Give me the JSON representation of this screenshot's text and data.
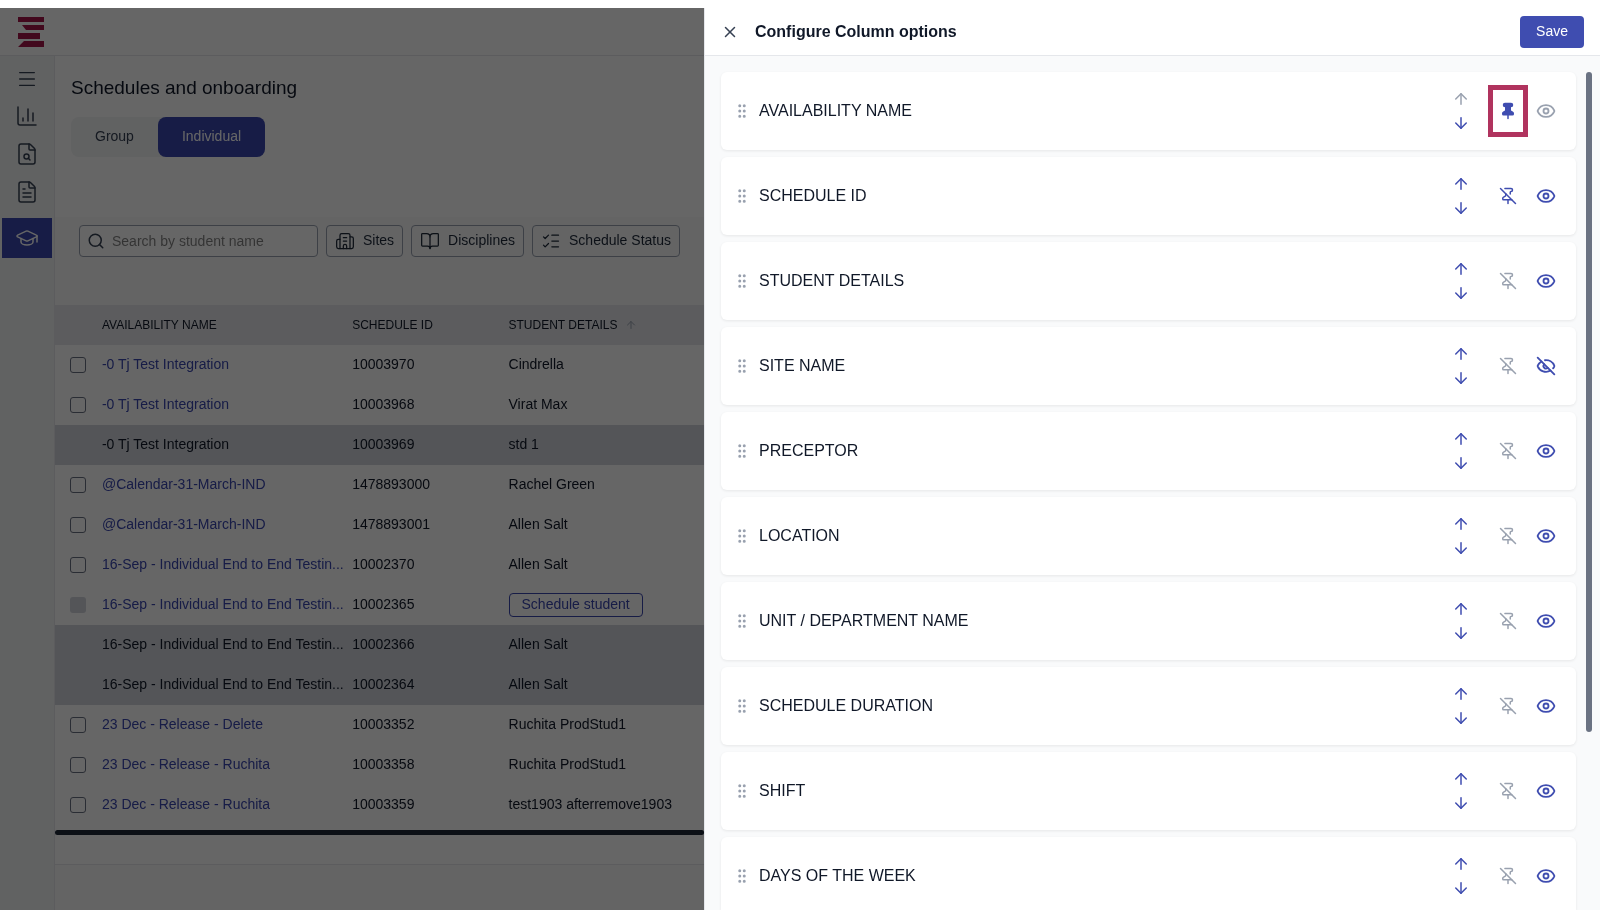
{
  "page": {
    "title": "Schedules and onboarding",
    "tabs": [
      {
        "label": "Group",
        "selected": false
      },
      {
        "label": "Individual",
        "selected": true
      }
    ],
    "search": {
      "placeholder": "Search by student name"
    },
    "filters": [
      {
        "label": "Sites",
        "kind": "sites"
      },
      {
        "label": "Disciplines",
        "kind": "book"
      },
      {
        "label": "Schedule Status",
        "kind": "list"
      }
    ],
    "table": {
      "columns": [
        {
          "label": "AVAILABILITY NAME",
          "sorted": false
        },
        {
          "label": "SCHEDULE ID",
          "sorted": false
        },
        {
          "label": "STUDENT DETAILS",
          "sorted": true
        }
      ],
      "rows": [
        {
          "checkbox": {
            "checked": false,
            "disabled": false
          },
          "name": "-0 Tj Test Integration",
          "link": true,
          "id": "10003970",
          "student": "Cindrella",
          "kind": "text",
          "shaded": false
        },
        {
          "checkbox": {
            "checked": false,
            "disabled": false
          },
          "name": "-0 Tj Test Integration",
          "link": true,
          "id": "10003968",
          "student": "Virat Max",
          "kind": "text",
          "shaded": false
        },
        {
          "name": "-0 Tj Test Integration",
          "link": false,
          "id": "10003969",
          "student": "std 1",
          "kind": "text",
          "shaded": true
        },
        {
          "checkbox": {
            "checked": false,
            "disabled": false
          },
          "name": "@Calendar-31-March-IND",
          "link": true,
          "id": "1478893000",
          "student": "Rachel Green",
          "kind": "text",
          "shaded": false
        },
        {
          "checkbox": {
            "checked": false,
            "disabled": false
          },
          "name": "@Calendar-31-March-IND",
          "link": true,
          "id": "1478893001",
          "student": "Allen Salt",
          "kind": "text",
          "shaded": false
        },
        {
          "checkbox": {
            "checked": false,
            "disabled": false
          },
          "name": "16-Sep - Individual End to End Testin...",
          "link": true,
          "id": "10002370",
          "student": "Allen Salt",
          "kind": "text",
          "shaded": false
        },
        {
          "checkbox": {
            "checked": false,
            "disabled": true
          },
          "name": "16-Sep - Individual End to End Testin...",
          "link": true,
          "id": "10002365",
          "student": "Schedule student",
          "kind": "button",
          "shaded": false
        },
        {
          "name": "16-Sep - Individual End to End Testin...",
          "link": false,
          "id": "10002366",
          "student": "Allen Salt",
          "kind": "text",
          "shaded": true
        },
        {
          "name": "16-Sep - Individual End to End Testin...",
          "link": false,
          "id": "10002364",
          "student": "Allen Salt",
          "kind": "text",
          "shaded": true
        },
        {
          "checkbox": {
            "checked": false,
            "disabled": false
          },
          "name": "23 Dec - Release - Delete",
          "link": true,
          "id": "10003352",
          "student": "Ruchita ProdStud1",
          "kind": "text",
          "shaded": false
        },
        {
          "checkbox": {
            "checked": false,
            "disabled": false
          },
          "name": "23 Dec - Release - Ruchita",
          "link": true,
          "id": "10003358",
          "student": "Ruchita ProdStud1",
          "kind": "text",
          "shaded": false
        },
        {
          "checkbox": {
            "checked": false,
            "disabled": false
          },
          "name": "23 Dec - Release - Ruchita",
          "link": true,
          "id": "10003359",
          "student": "test1903 afterremove1903",
          "kind": "text",
          "shaded": false
        }
      ]
    }
  },
  "drawer": {
    "title": "Configure Column options",
    "save": "Save",
    "columns": [
      {
        "label": "AVAILABILITY NAME",
        "up_disabled": true,
        "pinned": true,
        "pin_disabled": false,
        "highlighted": true,
        "visible": true,
        "eye_disabled": true
      },
      {
        "label": "SCHEDULE ID",
        "up_disabled": false,
        "pinned": false,
        "pin_disabled": false,
        "highlighted": false,
        "visible": true,
        "eye_disabled": false
      },
      {
        "label": "STUDENT DETAILS",
        "up_disabled": false,
        "pinned": false,
        "pin_disabled": true,
        "highlighted": false,
        "visible": true,
        "eye_disabled": false
      },
      {
        "label": "SITE NAME",
        "up_disabled": false,
        "pinned": false,
        "pin_disabled": true,
        "highlighted": false,
        "visible": false,
        "eye_disabled": false
      },
      {
        "label": "PRECEPTOR",
        "up_disabled": false,
        "pinned": false,
        "pin_disabled": true,
        "highlighted": false,
        "visible": true,
        "eye_disabled": false
      },
      {
        "label": "LOCATION",
        "up_disabled": false,
        "pinned": false,
        "pin_disabled": true,
        "highlighted": false,
        "visible": true,
        "eye_disabled": false
      },
      {
        "label": "UNIT / DEPARTMENT NAME",
        "up_disabled": false,
        "pinned": false,
        "pin_disabled": true,
        "highlighted": false,
        "visible": true,
        "eye_disabled": false
      },
      {
        "label": "SCHEDULE DURATION",
        "up_disabled": false,
        "pinned": false,
        "pin_disabled": true,
        "highlighted": false,
        "visible": true,
        "eye_disabled": false
      },
      {
        "label": "SHIFT",
        "up_disabled": false,
        "pinned": false,
        "pin_disabled": true,
        "highlighted": false,
        "visible": true,
        "eye_disabled": false
      },
      {
        "label": "DAYS OF THE WEEK",
        "up_disabled": false,
        "pinned": false,
        "pin_disabled": true,
        "highlighted": false,
        "visible": true,
        "eye_disabled": false
      }
    ]
  }
}
